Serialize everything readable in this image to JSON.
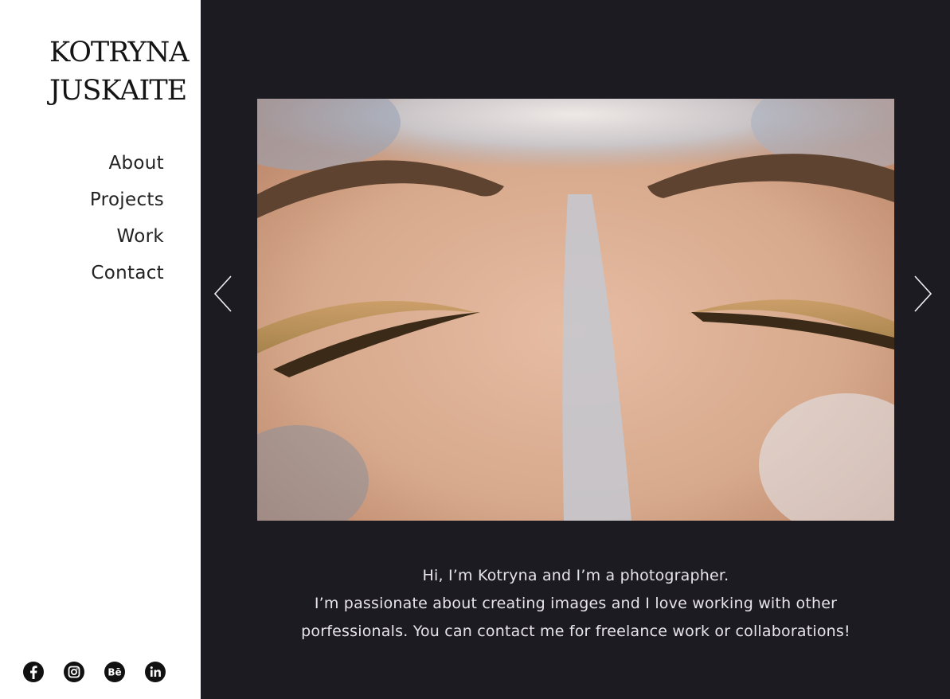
{
  "brand": {
    "line1": "KOTRYNA",
    "line2": "JUSKAITE"
  },
  "nav": {
    "items": [
      {
        "label": "About"
      },
      {
        "label": "Projects"
      },
      {
        "label": "Work"
      },
      {
        "label": "Contact"
      }
    ]
  },
  "social": {
    "icons": [
      "facebook-icon",
      "instagram-icon",
      "behance-icon",
      "linkedin-icon"
    ]
  },
  "slider": {
    "prev_icon": "chevron-left-icon",
    "next_icon": "chevron-right-icon"
  },
  "intro": {
    "line1": "Hi, I’m Kotryna and I’m a photographer.",
    "line2": "I’m passionate about creating images and I love working with other",
    "line3": "porfessionals. You can contact me for freelance work or collaborations!"
  },
  "colors": {
    "background": "#1c1b21",
    "sidebar": "#ffffff",
    "text_dark": "#222222",
    "text_light": "#e7e4ea"
  }
}
